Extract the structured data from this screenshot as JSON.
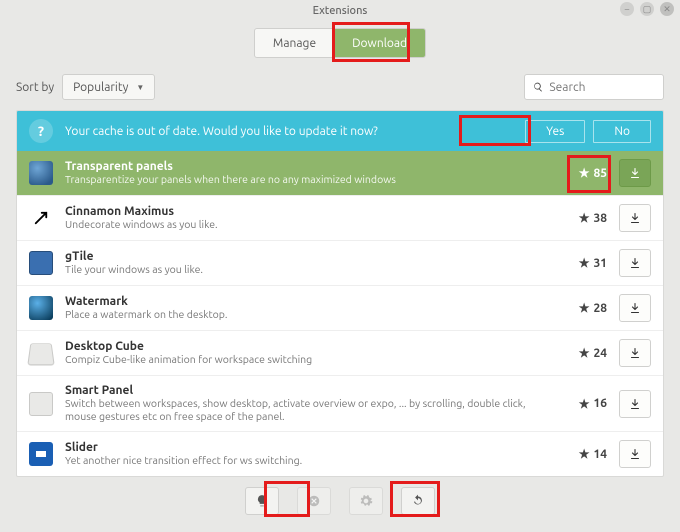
{
  "window": {
    "title": "Extensions"
  },
  "tabs": {
    "manage": "Manage",
    "download": "Download",
    "active": "download"
  },
  "sort": {
    "label": "Sort by",
    "value": "Popularity"
  },
  "search": {
    "placeholder": "Search"
  },
  "banner": {
    "message": "Your cache is out of date. Would you like to update it now?",
    "yes": "Yes",
    "no": "No"
  },
  "extensions": [
    {
      "name": "Transparent panels",
      "desc": "Transparentize your panels when there are no any maximized windows",
      "stars": 85,
      "selected": true,
      "icon": "tp"
    },
    {
      "name": "Cinnamon Maximus",
      "desc": "Undecorate windows as you like.",
      "stars": 38,
      "selected": false,
      "icon": "cm"
    },
    {
      "name": "gTile",
      "desc": "Tile your windows as you like.",
      "stars": 31,
      "selected": false,
      "icon": "gt"
    },
    {
      "name": "Watermark",
      "desc": "Place a watermark on the desktop.",
      "stars": 28,
      "selected": false,
      "icon": "wm"
    },
    {
      "name": "Desktop Cube",
      "desc": "Compiz Cube-like animation for workspace switching",
      "stars": 24,
      "selected": false,
      "icon": "dc"
    },
    {
      "name": "Smart Panel",
      "desc": "Switch between workspaces, show desktop, activate overview or expo, ... by scrolling, double click, mouse gestures etc on free space of the panel.",
      "stars": 16,
      "selected": false,
      "icon": "sp"
    },
    {
      "name": "Slider",
      "desc": "Yet another nice transition effect for ws switching.",
      "stars": 14,
      "selected": false,
      "icon": "sl"
    }
  ],
  "toolbar": {
    "about": "about",
    "remove": "remove",
    "settings": "settings",
    "refresh": "refresh"
  }
}
